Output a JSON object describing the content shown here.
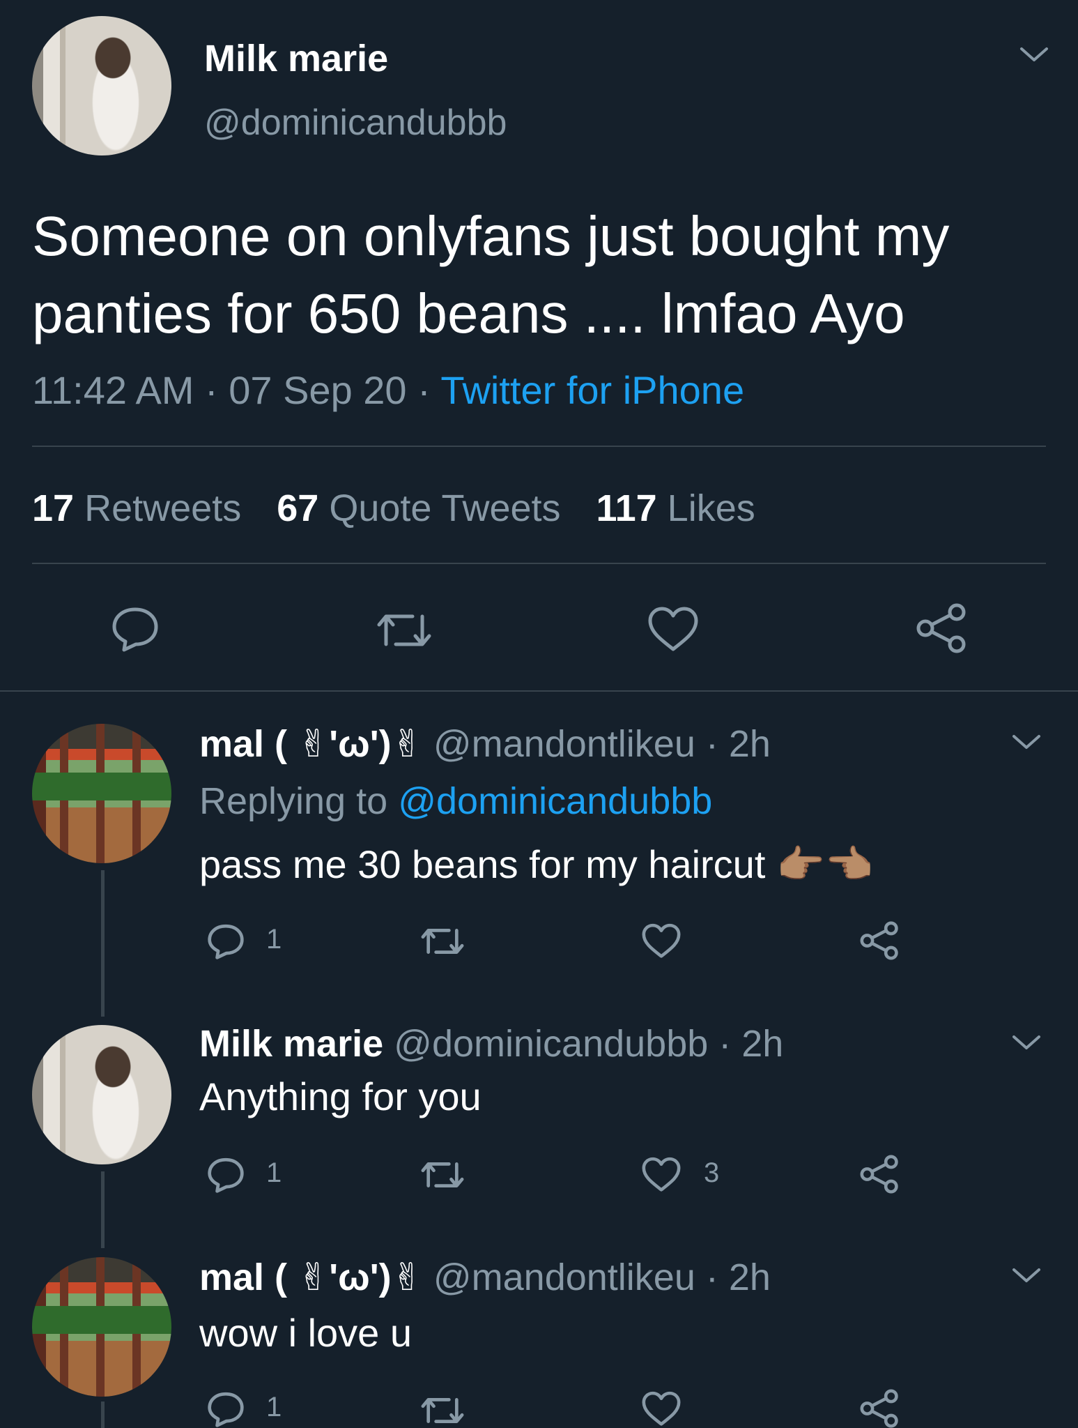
{
  "main_tweet": {
    "display_name": "Milk marie",
    "handle": "@dominicandubbb",
    "text_line1": "Someone on onlyfans just bought my",
    "text_line2": "panties for 650 beans .... lmfao Ayo",
    "time": "11:42 AM",
    "date": "07 Sep 20",
    "separator": "·",
    "source": "Twitter for iPhone",
    "stats": {
      "retweets_count": "17",
      "retweets_label": "Retweets",
      "quotes_count": "67",
      "quotes_label": "Quote Tweets",
      "likes_count": "117",
      "likes_label": "Likes"
    }
  },
  "replies": [
    {
      "display_name": "mal ( ✌︎'ω')✌︎",
      "handle": "@mandontlikeu",
      "time": "· 2h",
      "replying_prefix": "Replying to",
      "replying_handle": "@dominicandubbb",
      "text": "pass me 30 beans for my haircut 👉🏽👈🏽",
      "reply_count": "1",
      "like_count": ""
    },
    {
      "display_name": "Milk marie",
      "handle": "@dominicandubbb",
      "time": "· 2h",
      "text": "Anything for you",
      "reply_count": "1",
      "like_count": "3"
    },
    {
      "display_name": "mal ( ✌︎'ω')✌︎",
      "handle": "@mandontlikeu",
      "time": "· 2h",
      "text": "wow i love u",
      "reply_count": "1",
      "like_count": ""
    }
  ],
  "colors": {
    "background": "#15202b",
    "secondary_text": "#8899a6",
    "link": "#1da1f2",
    "divider": "#38444d"
  },
  "icons": [
    "chevron-down-icon",
    "reply-icon",
    "retweet-icon",
    "like-icon",
    "share-icon"
  ]
}
